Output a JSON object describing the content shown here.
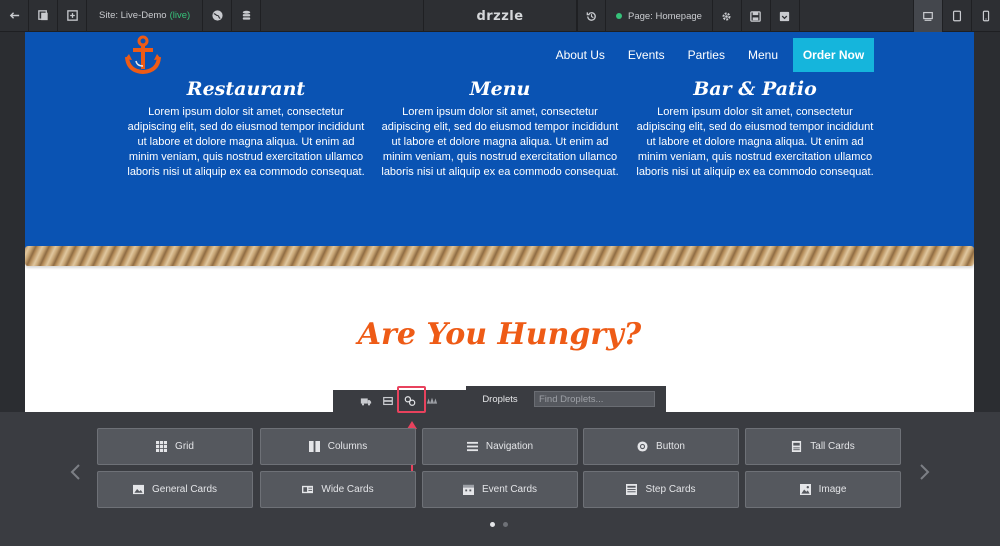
{
  "toolbar": {
    "site_label": "Site: Live-Demo",
    "site_status": "(live)",
    "logo": "drzzle",
    "page_label": "Page: Homepage"
  },
  "site": {
    "nav": [
      "About Us",
      "Events",
      "Parties",
      "Menu"
    ],
    "cta": "Order Now",
    "columns": [
      {
        "title": "Restaurant",
        "body": "Lorem ipsum dolor sit amet, consectetur adipiscing elit, sed do eiusmod tempor incididunt ut labore et dolore magna aliqua. Ut enim ad minim veniam, quis nostrud exercitation ullamco laboris nisi ut aliquip ex ea commodo consequat."
      },
      {
        "title": "Menu",
        "body": "Lorem ipsum dolor sit amet, consectetur adipiscing elit, sed do eiusmod tempor incididunt ut labore et dolore magna aliqua. Ut enim ad minim veniam, quis nostrud exercitation ullamco laboris nisi ut aliquip ex ea commodo consequat."
      },
      {
        "title": "Bar & Patio",
        "body": "Lorem ipsum dolor sit amet, consectetur adipiscing elit, sed do eiusmod tempor incididunt ut labore et dolore magna aliqua. Ut enim ad minim veniam, quis nostrud exercitation ullamco laboris nisi ut aliquip ex ea commodo consequat."
      }
    ],
    "hungry": "Are You Hungry?"
  },
  "droplets": {
    "tab_label": "Droplets",
    "search_placeholder": "Find Droplets...",
    "items": [
      "Grid",
      "Columns",
      "Navigation",
      "Button",
      "Tall Cards",
      "General Cards",
      "Wide Cards",
      "Event Cards",
      "Step Cards",
      "Image"
    ]
  },
  "colors": {
    "hero_blue": "#0a53b3",
    "cta_cyan": "#15b5dc",
    "accent_orange": "#ee5b16",
    "live_green": "#36c27a",
    "highlight_red": "#e8425d"
  }
}
